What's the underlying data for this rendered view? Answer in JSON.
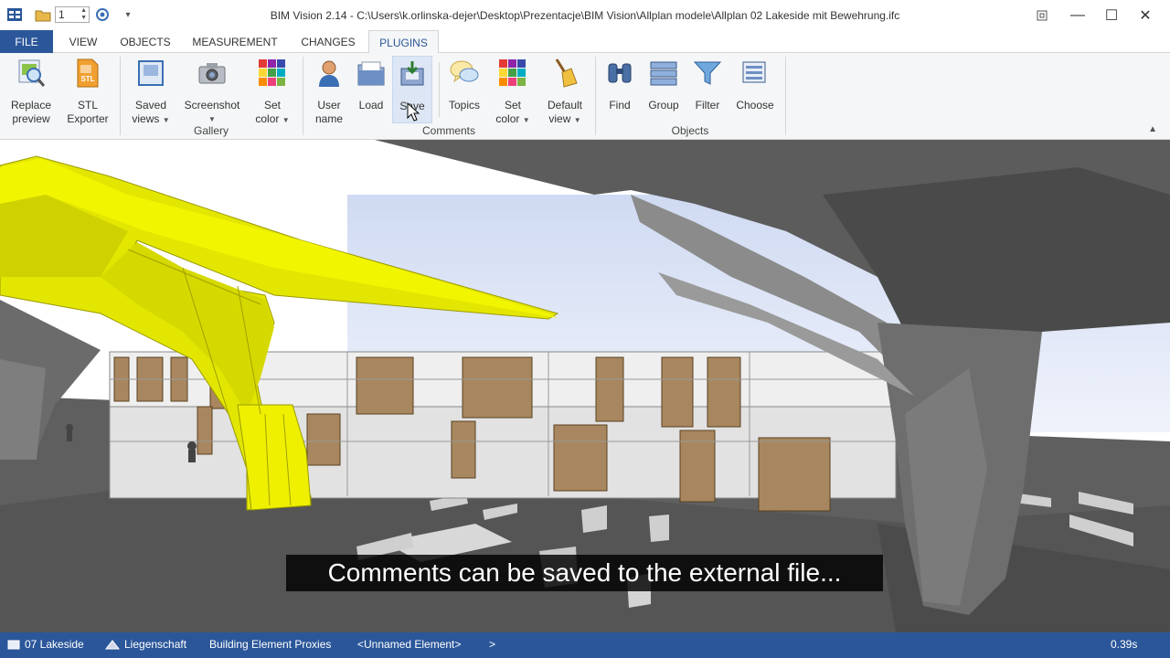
{
  "window": {
    "title": "BIM Vision 2.14 - C:\\Users\\k.orlinska-dejer\\Desktop\\Prezentacje\\BIM Vision\\Allplan modele\\Allplan 02 Lakeside mit Bewehrung.ifc",
    "quick_access_value": "1",
    "minimize": "—",
    "maximize": "☐",
    "close": "✕"
  },
  "tabs": {
    "file": "FILE",
    "view": "VIEW",
    "objects": "OBJECTS",
    "measurement": "MEASUREMENT",
    "changes": "CHANGES",
    "plugins": "PLUGINS"
  },
  "ribbon": {
    "replace_preview": [
      "Replace",
      "preview"
    ],
    "stl_exporter": [
      "STL",
      "Exporter"
    ],
    "stl_badge": "STL",
    "saved_views": [
      "Saved",
      "views"
    ],
    "screenshot": [
      "Screenshot"
    ],
    "set_color": [
      "Set",
      "color"
    ],
    "user_name": [
      "User",
      "name"
    ],
    "load": [
      "Load"
    ],
    "save": [
      "Save"
    ],
    "topics": [
      "Topics"
    ],
    "set_color_2": [
      "Set",
      "color"
    ],
    "default_view": [
      "Default",
      "view"
    ],
    "find": [
      "Find"
    ],
    "group": [
      "Group"
    ],
    "filter": [
      "Filter"
    ],
    "choose": [
      "Choose"
    ],
    "groups": {
      "gallery": "Gallery",
      "comments": "Comments",
      "objects": "Objects"
    }
  },
  "subtitle": "Comments can be saved to the external file...",
  "status": {
    "project": "07 Lakeside",
    "site": "Liegenschaft",
    "proxies": "Building Element Proxies",
    "element": "<Unnamed Element>",
    "arrow": ">",
    "time": "0.39s"
  },
  "colors": {
    "accent": "#2b579a",
    "ribbon_bg": "#f5f6f7",
    "highlight_yellow": "#e6e600",
    "model_gray": "#6e6e6e",
    "sky": "#dfe6f7",
    "panel_wood": "#a88760"
  },
  "icons": {
    "app": "app-grid-icon",
    "open": "folder-open-icon",
    "circle": "target-icon",
    "replace_preview": "magnifier-image-icon",
    "stl": "stl-file-icon",
    "saved_views": "saved-view-icon",
    "screenshot": "camera-icon",
    "set_color": "color-grid-icon",
    "user": "user-icon",
    "load": "load-folder-icon",
    "save": "save-disk-icon",
    "topics": "speech-bubble-icon",
    "default_view": "broom-icon",
    "find": "binoculars-icon",
    "group": "group-layers-icon",
    "filter": "funnel-icon",
    "choose": "choose-list-icon"
  }
}
